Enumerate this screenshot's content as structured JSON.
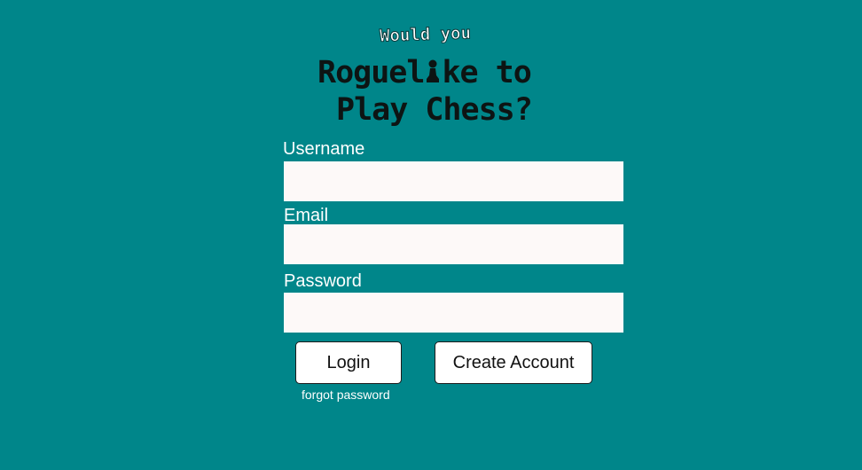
{
  "logo": {
    "tagline": "Would you",
    "title_part1": "Roguel",
    "title_piece_icon": "chess-pawn-icon",
    "title_part2": "ke to",
    "title_line2": "Play Chess?"
  },
  "form": {
    "username": {
      "label": "Username",
      "value": "",
      "placeholder": ""
    },
    "email": {
      "label": "Email",
      "value": "",
      "placeholder": ""
    },
    "password": {
      "label": "Password",
      "value": "",
      "placeholder": ""
    }
  },
  "buttons": {
    "login_label": "Login",
    "create_account_label": "Create Account"
  },
  "forgot_password_label": "forgot password",
  "colors": {
    "background": "#00868a",
    "input_background": "#fdf9f8",
    "title_text": "#0d1413",
    "label_text": "#ffffff"
  }
}
